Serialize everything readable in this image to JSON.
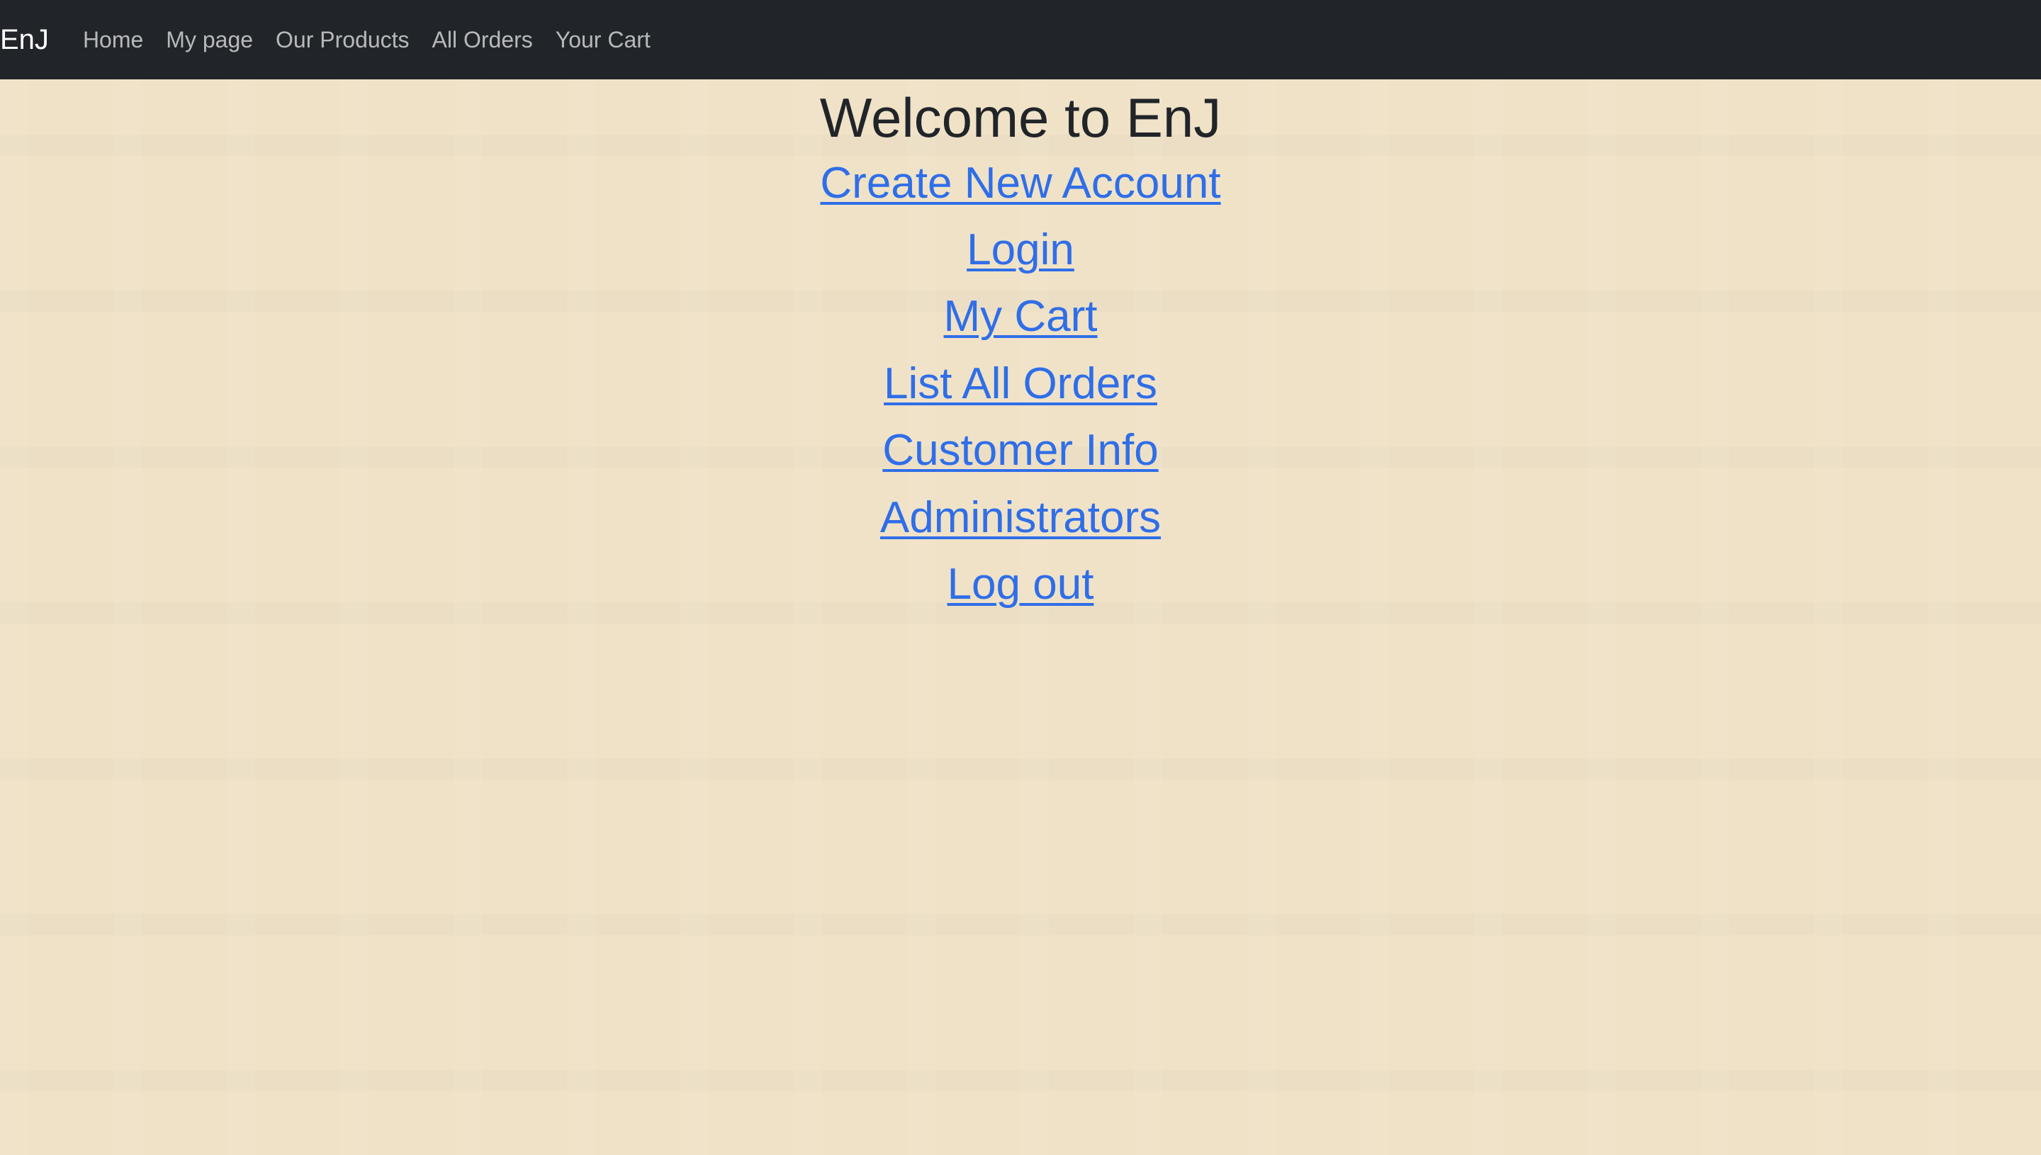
{
  "navbar": {
    "brand": "EnJ",
    "links": [
      "Home",
      "My page",
      "Our Products",
      "All Orders",
      "Your Cart"
    ]
  },
  "main": {
    "title": "Welcome to EnJ",
    "links": [
      "Create New Account",
      "Login",
      "My Cart",
      "List All Orders",
      "Customer Info",
      "Administrators",
      "Log out"
    ]
  }
}
